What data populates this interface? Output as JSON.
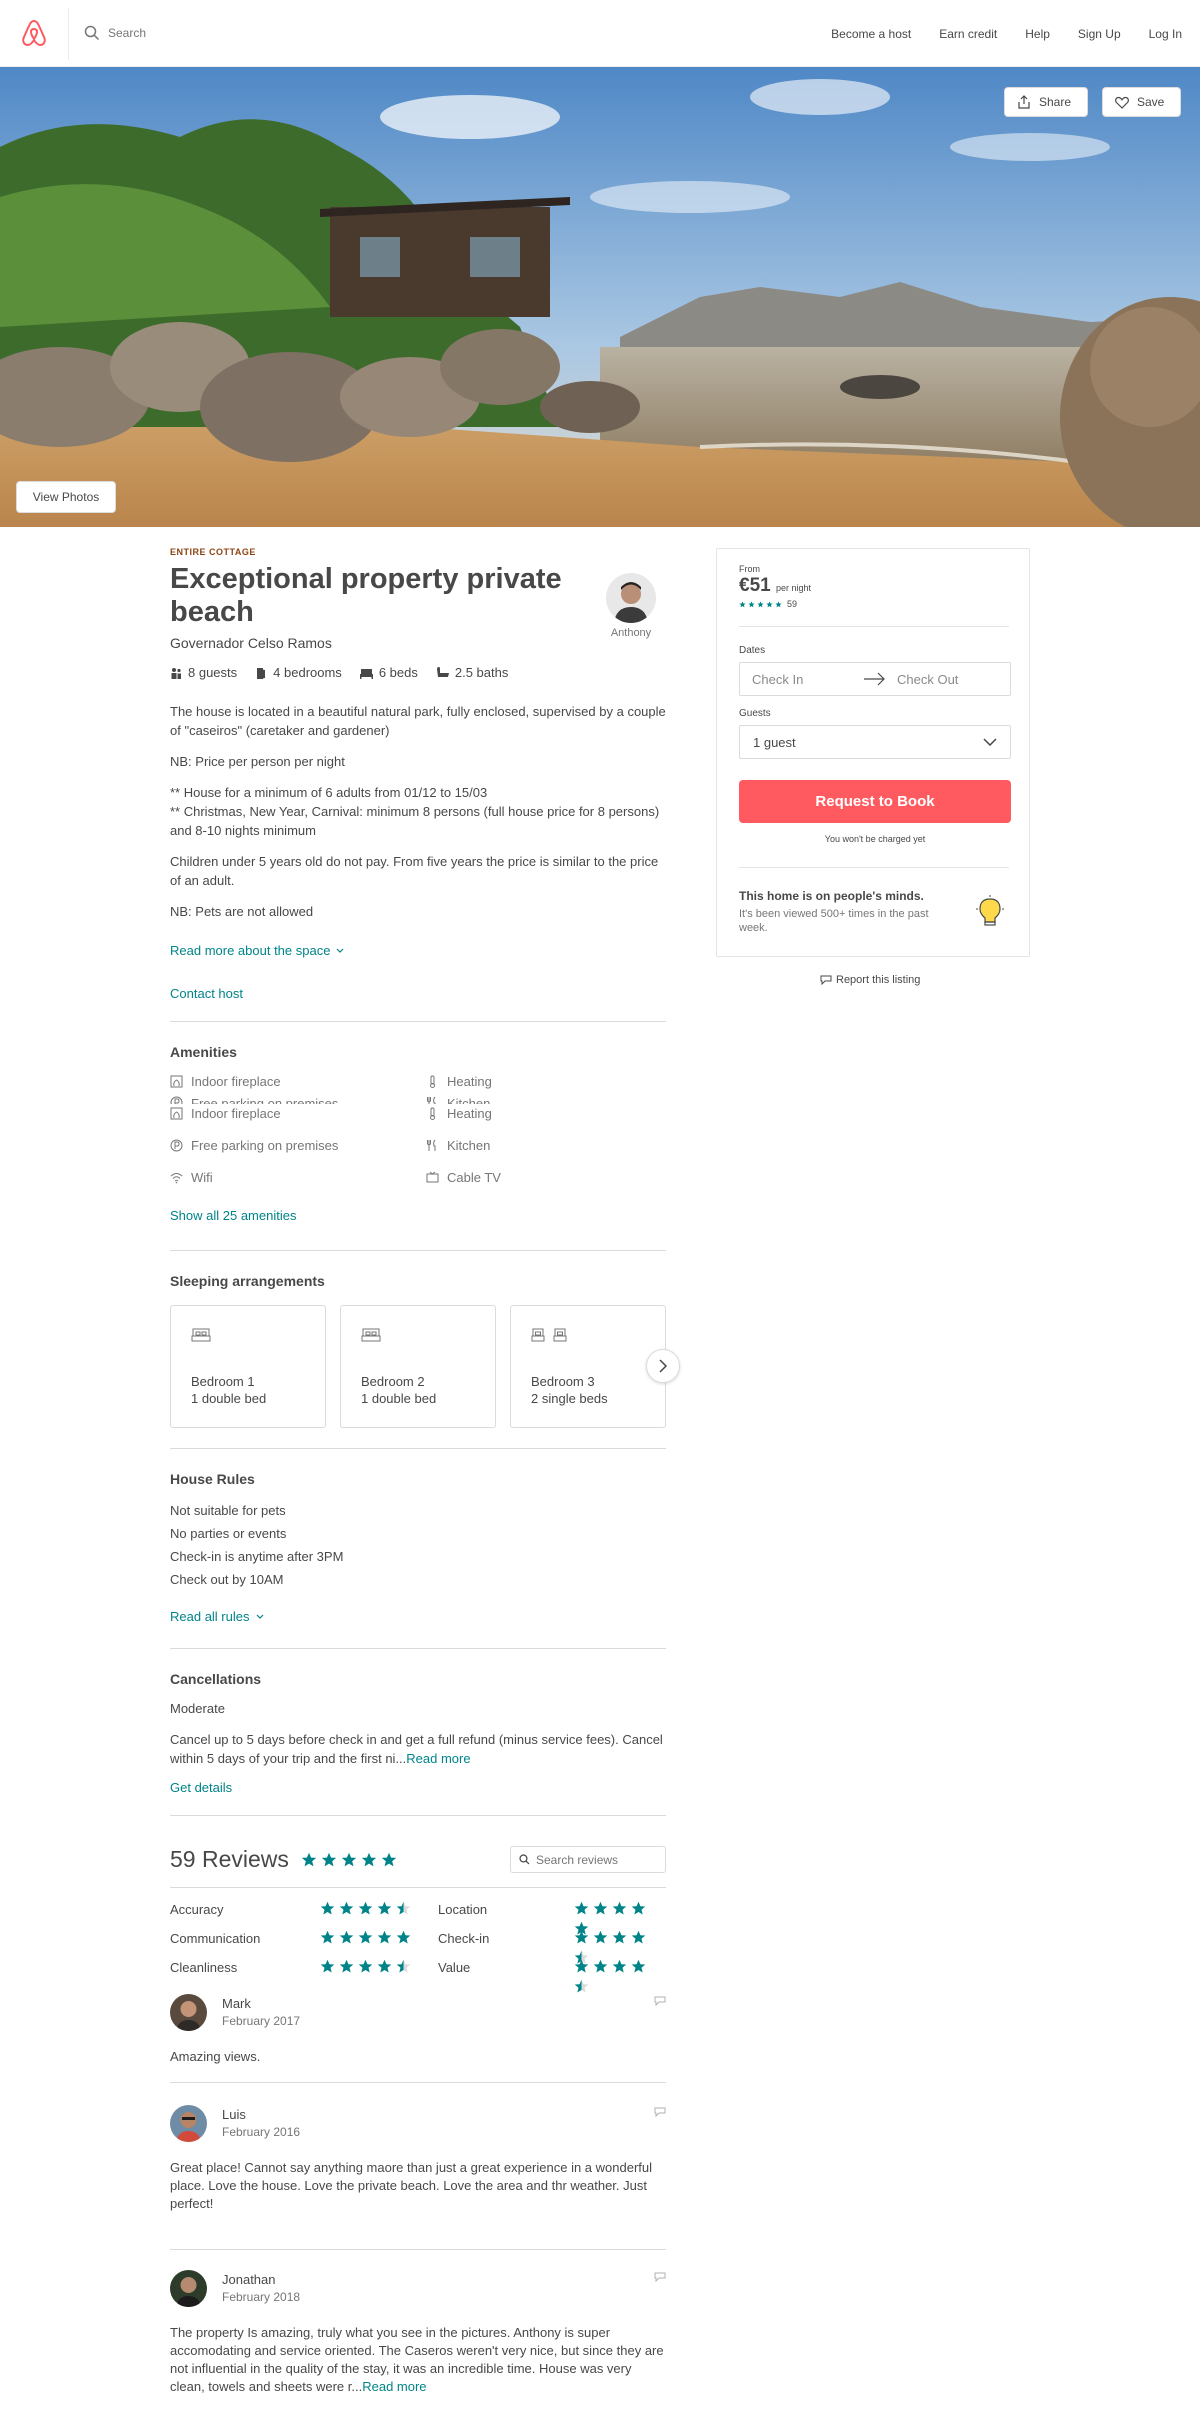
{
  "header": {
    "search_placeholder": "Search",
    "nav": [
      "Become a host",
      "Earn credit",
      "Help",
      "Sign Up",
      "Log In"
    ]
  },
  "hero": {
    "share_label": "Share",
    "save_label": "Save",
    "view_photos_label": "View Photos"
  },
  "listing": {
    "kicker": "ENTIRE COTTAGE",
    "title": "Exceptional property private beach",
    "location": "Governador Celso Ramos",
    "host_name": "Anthony",
    "specs": [
      {
        "icon": "guests-icon",
        "label": "8 guests"
      },
      {
        "icon": "bedrooms-icon",
        "label": "4 bedrooms"
      },
      {
        "icon": "beds-icon",
        "label": "6 beds"
      },
      {
        "icon": "baths-icon",
        "label": "2.5 baths"
      }
    ],
    "description": [
      "The house is located in a beautiful natural park, fully enclosed, supervised by a couple of \"caseiros\" (caretaker and gardener)",
      "NB: Price per person per night",
      "** House for a minimum of 6 adults from 01/12 to 15/03\n** Christmas, New Year, Carnival: minimum 8 persons (full house price for 8 persons) and 8-10 nights minimum",
      "Children under 5 years old do not pay. From five years the price is similar to the price of an adult.",
      "NB: Pets are not allowed"
    ],
    "read_more_label": "Read more about the space",
    "contact_host_label": "Contact host"
  },
  "amenities": {
    "title": "Amenities",
    "ghost": [
      "Indoor fireplace",
      "Heating",
      "Free parking on premises",
      "Kitchen"
    ],
    "items": [
      "Indoor fireplace",
      "Heating",
      "Free parking on premises",
      "Kitchen",
      "Wifi",
      "Cable TV"
    ],
    "show_all_label": "Show all 25 amenities"
  },
  "sleeping": {
    "title": "Sleeping arrangements",
    "rooms": [
      {
        "name": "Bedroom 1",
        "detail": "1 double bed"
      },
      {
        "name": "Bedroom 2",
        "detail": "1 double bed"
      },
      {
        "name": "Bedroom 3",
        "detail": "2 single beds"
      }
    ]
  },
  "house_rules": {
    "title": "House Rules",
    "rules": [
      "Not suitable for pets",
      "No parties or events",
      "Check-in is anytime after 3PM",
      "Check out by 10AM"
    ],
    "read_all_label": "Read all rules"
  },
  "cancellations": {
    "title": "Cancellations",
    "policy": "Moderate",
    "text": "Cancel up to 5 days before check in and get a full refund (minus service fees). Cancel within 5 days of your trip and the first ni...",
    "read_more_label": "Read more",
    "get_details_label": "Get details"
  },
  "reviews": {
    "title": "59 Reviews",
    "overall_stars": 5,
    "search_placeholder": "Search reviews",
    "ratings": [
      {
        "label": "Accuracy",
        "stars": 4.5
      },
      {
        "label": "Location",
        "stars": 5
      },
      {
        "label": "Communication",
        "stars": 5
      },
      {
        "label": "Check-in",
        "stars": 4.5
      },
      {
        "label": "Cleanliness",
        "stars": 4.5
      },
      {
        "label": "Value",
        "stars": 4.5
      }
    ],
    "items": [
      {
        "name": "Mark",
        "date": "February 2017",
        "text": "Amazing views.",
        "more": ""
      },
      {
        "name": "Luis",
        "date": "February 2016",
        "text": "Great place! Cannot say anything maore than just a great experience in a wonderful place. Love the house. Love the private beach. Love the area and thr weather. Just perfect!",
        "more": ""
      },
      {
        "name": "Jonathan",
        "date": "February 2018",
        "text": "The property Is amazing, truly what you see in the pictures. Anthony is super accomodating and service oriented. The Caseros weren't very nice, but since they are not influential in the quality of the stay, it was an incredible time. House was very clean, towels and sheets were r...",
        "more": "Read more"
      }
    ]
  },
  "booking": {
    "from_label": "From",
    "price": "€51",
    "per_night": "per night",
    "review_count": "59",
    "dates_label": "Dates",
    "check_in_placeholder": "Check In",
    "check_out_placeholder": "Check Out",
    "guests_label": "Guests",
    "guests_value": "1 guest",
    "request_label": "Request to Book",
    "charged_note": "You won't be charged yet",
    "minds_title": "This home is on people's minds.",
    "minds_text": "It's been viewed 500+ times in the past week.",
    "report_label": "Report this listing"
  },
  "colors": {
    "teal": "#008489",
    "rausch": "#ff5a5f",
    "text": "#484848",
    "kicker": "#8b4513"
  }
}
